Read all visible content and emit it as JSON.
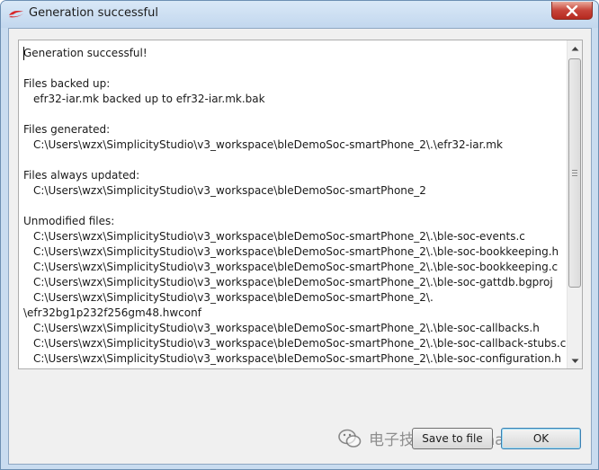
{
  "window": {
    "title": "Generation successful",
    "close_icon": "close-icon",
    "colors": {
      "frame": "#c9dcf0",
      "close": "#c7443a"
    }
  },
  "log": {
    "lines": [
      {
        "text": "Generation successful!",
        "indent": false
      },
      {
        "text": "",
        "indent": false
      },
      {
        "text": "Files backed up:",
        "indent": false
      },
      {
        "text": "efr32-iar.mk backed up to efr32-iar.mk.bak",
        "indent": true
      },
      {
        "text": "",
        "indent": false
      },
      {
        "text": "Files generated:",
        "indent": false
      },
      {
        "text": "C:\\Users\\wzx\\SimplicityStudio\\v3_workspace\\bleDemoSoc-smartPhone_2\\.\\efr32-iar.mk",
        "indent": true
      },
      {
        "text": "",
        "indent": false
      },
      {
        "text": "Files always updated:",
        "indent": false
      },
      {
        "text": "C:\\Users\\wzx\\SimplicityStudio\\v3_workspace\\bleDemoSoc-smartPhone_2",
        "indent": true
      },
      {
        "text": "",
        "indent": false
      },
      {
        "text": "Unmodified files:",
        "indent": false
      },
      {
        "text": "C:\\Users\\wzx\\SimplicityStudio\\v3_workspace\\bleDemoSoc-smartPhone_2\\.\\ble-soc-events.c",
        "indent": true
      },
      {
        "text": "C:\\Users\\wzx\\SimplicityStudio\\v3_workspace\\bleDemoSoc-smartPhone_2\\.\\ble-soc-bookkeeping.h",
        "indent": true
      },
      {
        "text": "C:\\Users\\wzx\\SimplicityStudio\\v3_workspace\\bleDemoSoc-smartPhone_2\\.\\ble-soc-bookkeeping.c",
        "indent": true
      },
      {
        "text": "C:\\Users\\wzx\\SimplicityStudio\\v3_workspace\\bleDemoSoc-smartPhone_2\\.\\ble-soc-gattdb.bgproj",
        "indent": true
      },
      {
        "text": "C:\\Users\\wzx\\SimplicityStudio\\v3_workspace\\bleDemoSoc-smartPhone_2\\.",
        "indent": true
      },
      {
        "text": "\\efr32bg1p232f256gm48.hwconf",
        "indent": false
      },
      {
        "text": "C:\\Users\\wzx\\SimplicityStudio\\v3_workspace\\bleDemoSoc-smartPhone_2\\.\\ble-soc-callbacks.h",
        "indent": true
      },
      {
        "text": "C:\\Users\\wzx\\SimplicityStudio\\v3_workspace\\bleDemoSoc-smartPhone_2\\.\\ble-soc-callback-stubs.c",
        "indent": true
      },
      {
        "text": "C:\\Users\\wzx\\SimplicityStudio\\v3_workspace\\bleDemoSoc-smartPhone_2\\.\\ble-soc-configuration.h",
        "indent": true
      }
    ]
  },
  "buttons": {
    "save_label": "Save to file",
    "ok_label": "OK"
  },
  "watermark": {
    "text": "电子技术应用ChinaAET",
    "icon": "wechat-icon"
  }
}
